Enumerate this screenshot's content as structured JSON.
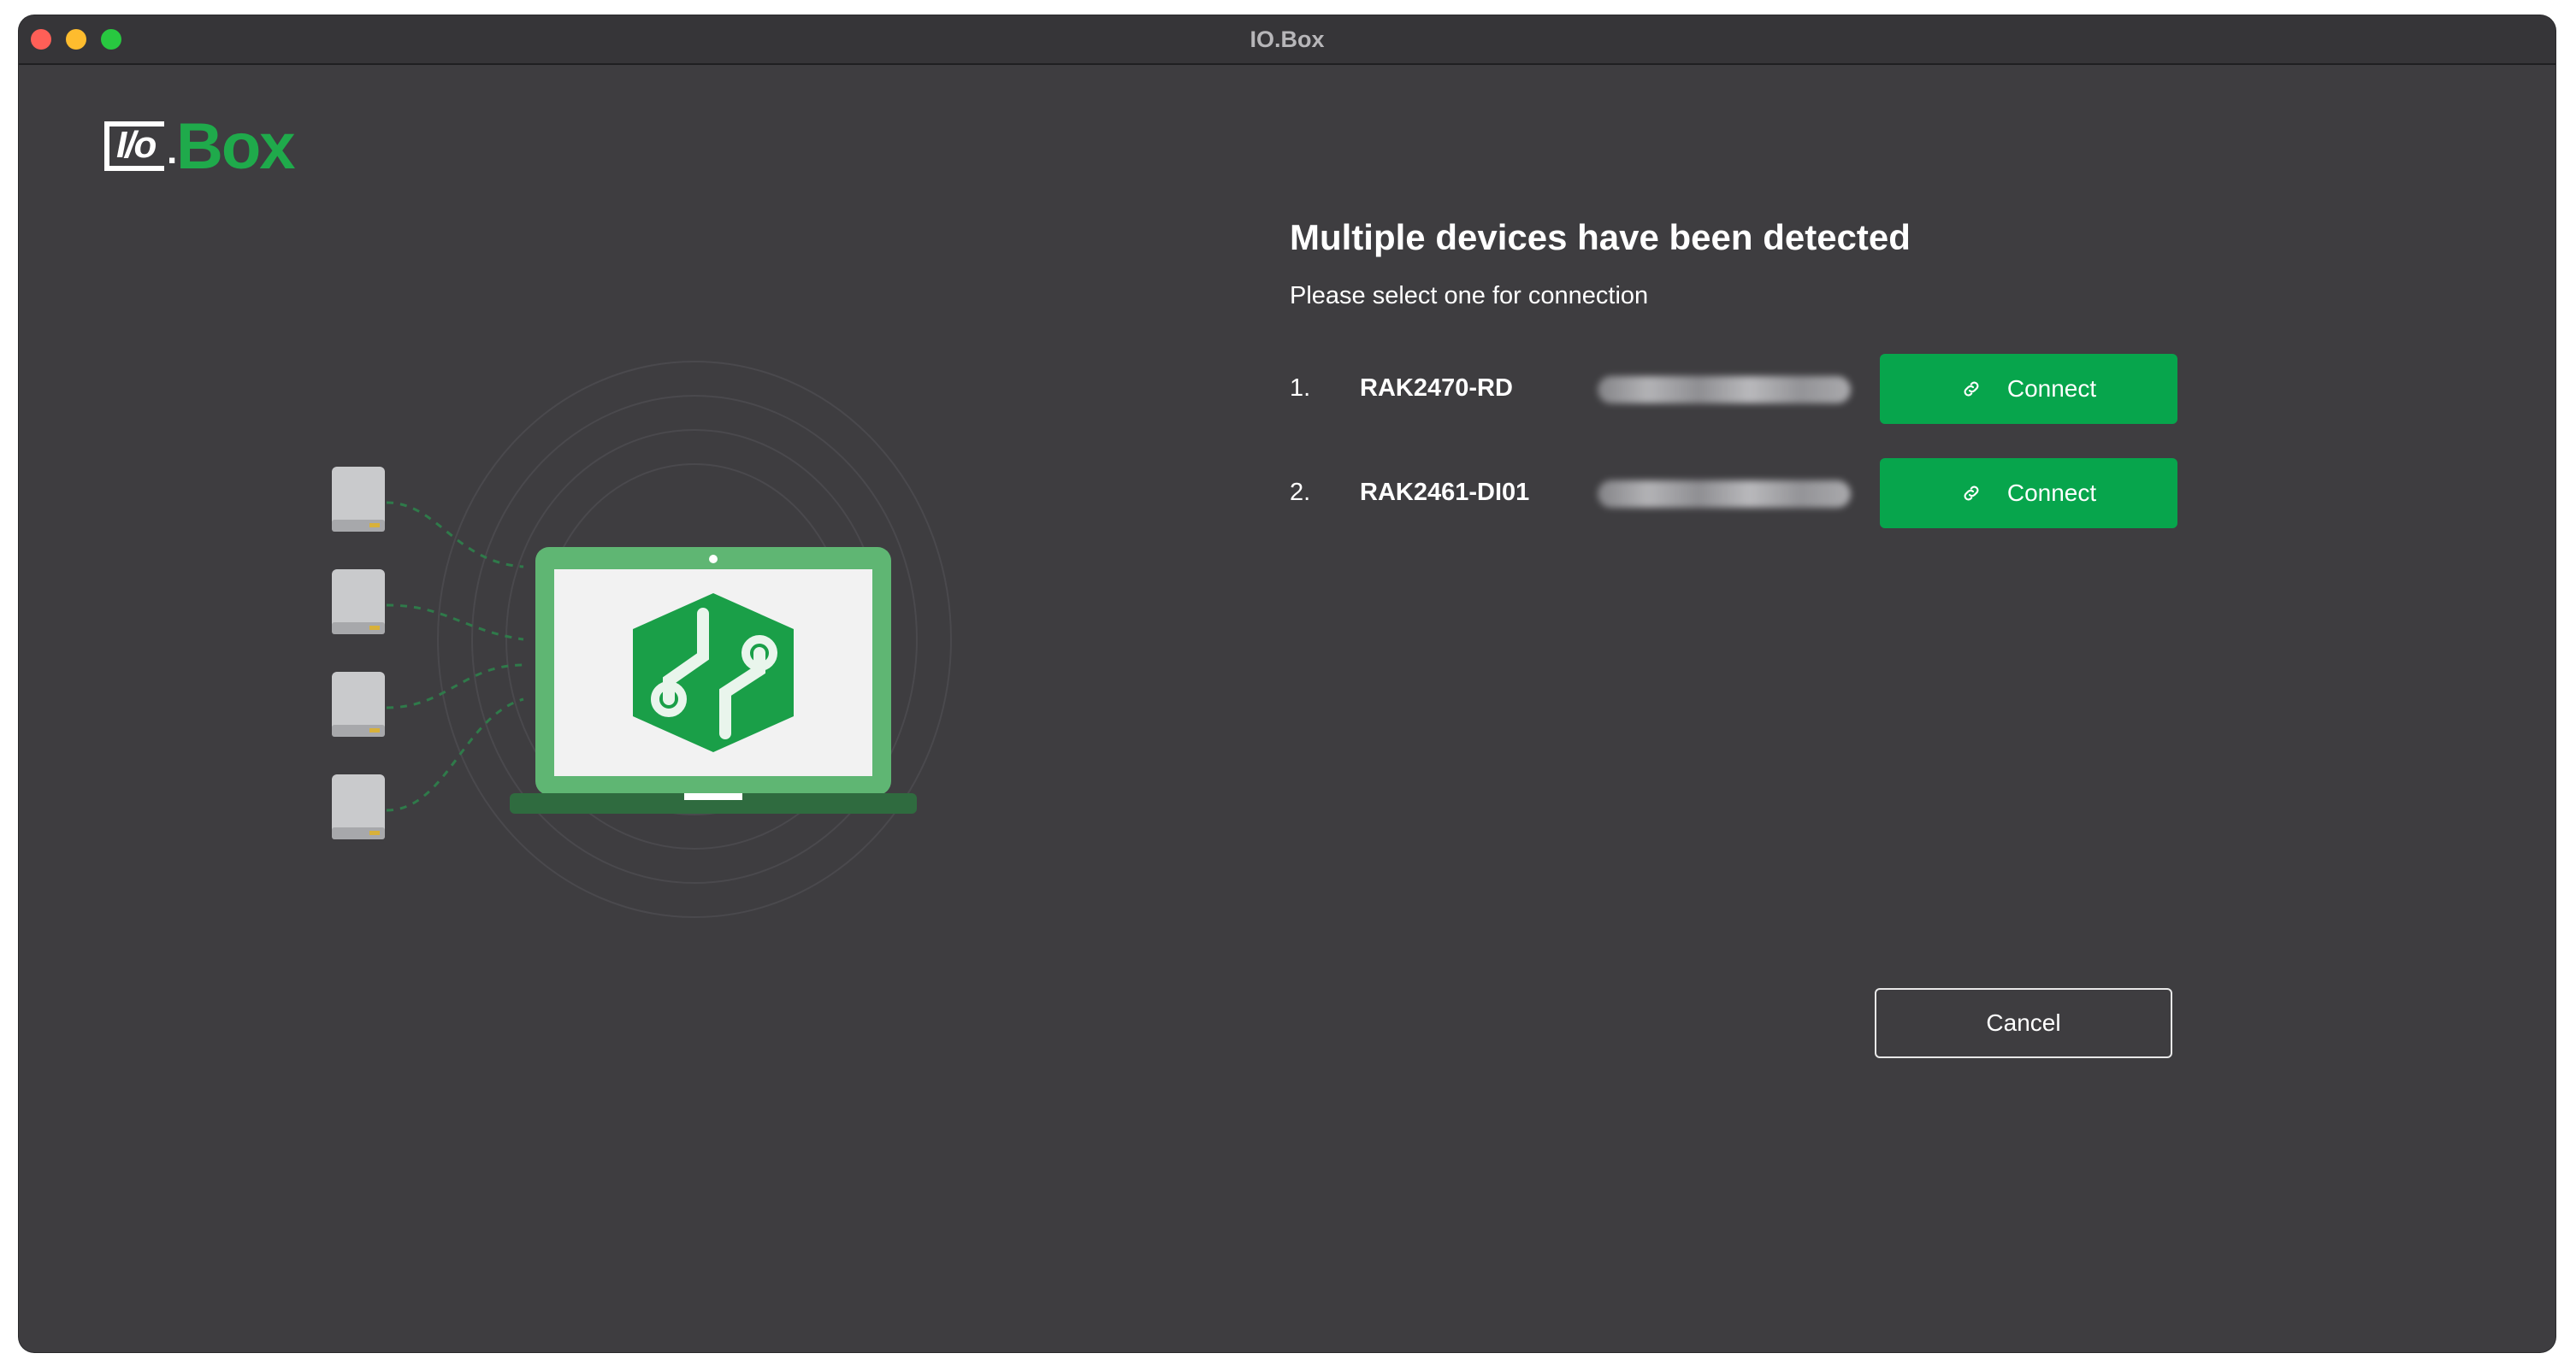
{
  "window": {
    "title": "IO.Box"
  },
  "logo": {
    "io_text": "I/o",
    "dot": ".",
    "word": "Box"
  },
  "dialog": {
    "heading": "Multiple devices have been detected",
    "subheading": "Please select one for connection",
    "devices": [
      {
        "index": "1.",
        "name": "RAK2470-RD",
        "connect_label": "Connect"
      },
      {
        "index": "2.",
        "name": "RAK2461-DI01",
        "connect_label": "Connect"
      }
    ],
    "cancel_label": "Cancel"
  },
  "colors": {
    "background": "#3e3d40",
    "accent": "#07a54c",
    "logo_green": "#1faa4b"
  },
  "icons": {
    "connect": "link-icon",
    "illustration": "laptop-devices-illustration"
  }
}
